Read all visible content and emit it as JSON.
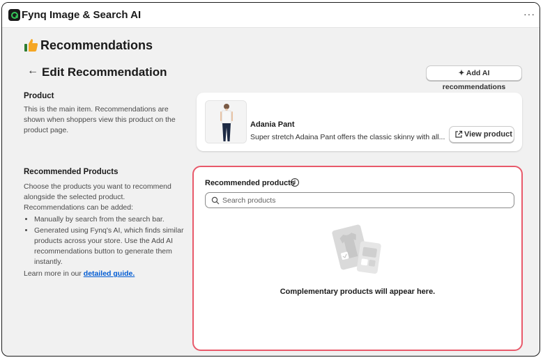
{
  "app": {
    "title": "Fynq Image & Search AI",
    "more_label": "···",
    "icon": "fynq-logo-icon"
  },
  "page": {
    "heading": "Recommendations",
    "heading_icon": "thumbs-up-icon"
  },
  "header": {
    "back_label": "←",
    "title": "Edit Recommendation",
    "ai_button_label": "✦ Add AI recommendations"
  },
  "product_section": {
    "title": "Product",
    "description": "This is the main item. Recommendations are shown when shoppers view this product on the product page."
  },
  "product": {
    "name": "Adania Pant",
    "description": "Super stretch Adaina Pant offers the classic skinny with all...",
    "view_button_label": "View product"
  },
  "recommended_section": {
    "title": "Recommended Products",
    "intro": "Choose the products you want to recommend alongside the selected product. Recommendations can be added:",
    "bullets": [
      "Manually by search from the search bar.",
      "Generated using Fynq's AI, which finds similar products across your store. Use the Add AI recommendations button to generate them instantly."
    ],
    "learn_more_prefix": "Learn more in our ",
    "guide_link": "detailed guide."
  },
  "recommended_card": {
    "title": "Recommended products",
    "info_glyph": "i",
    "search_placeholder": "Search products",
    "empty_text": "Complementary products will appear here."
  },
  "colors": {
    "highlight_border": "#e8596a",
    "link": "#005bd3",
    "brand_green": "#35c759"
  }
}
